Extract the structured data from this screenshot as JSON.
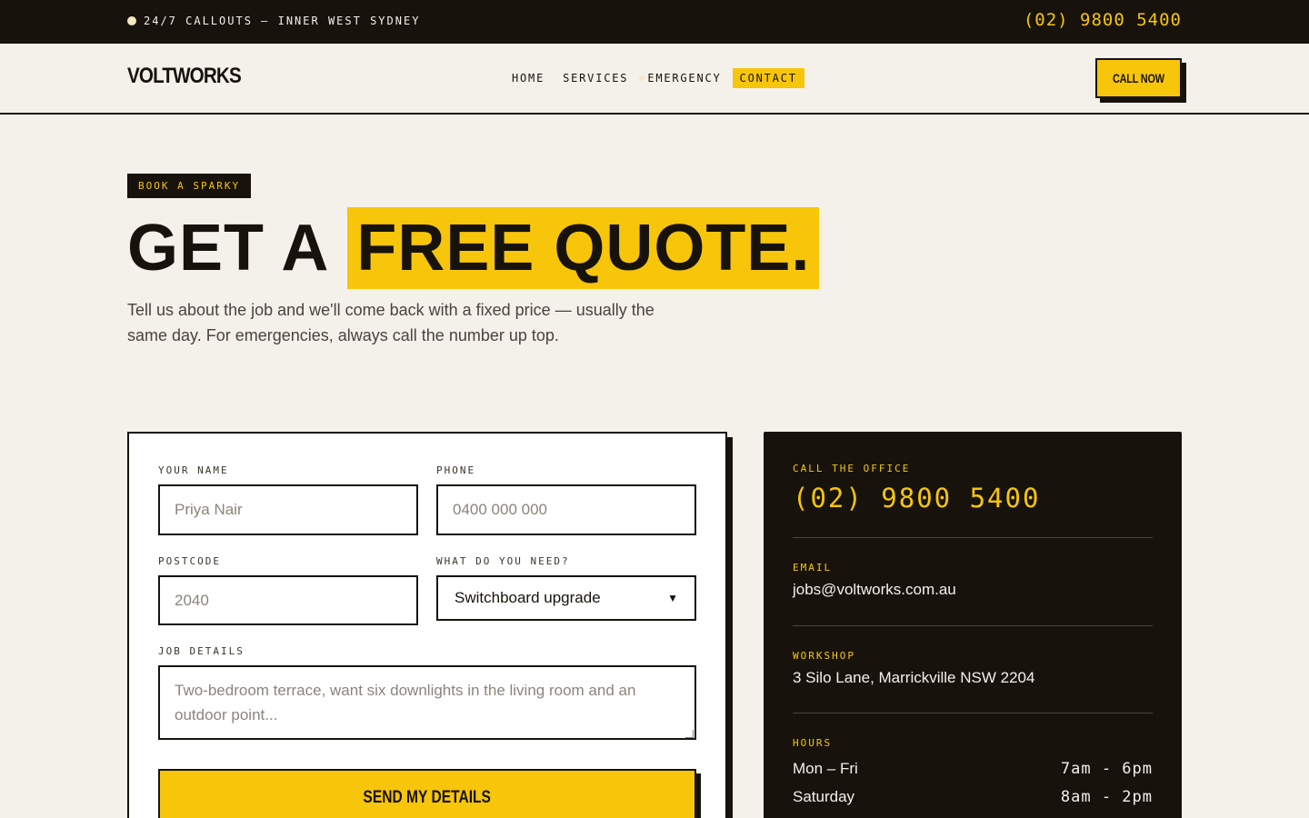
{
  "topbar": {
    "tagline": "24/7 CALLOUTS — INNER WEST SYDNEY",
    "phone": "(02) 9800 5400"
  },
  "header": {
    "logo": "VOLTWORKS",
    "nav": [
      {
        "label": "HOME"
      },
      {
        "label": "SERVICES"
      },
      {
        "label": "EMERGENCY"
      },
      {
        "label": "CONTACT",
        "active": true
      }
    ],
    "cta": "CALL NOW"
  },
  "hero": {
    "tag": "BOOK A SPARKY",
    "title_pre": "GET A",
    "title_highlight": "FREE QUOTE.",
    "lead": "Tell us about the job and we'll come back with a fixed price — usually the same day. For emergencies, always call the number up top."
  },
  "form": {
    "name_label": "YOUR NAME",
    "name_placeholder": "Priya Nair",
    "phone_label": "PHONE",
    "phone_placeholder": "0400 000 000",
    "postcode_label": "POSTCODE",
    "postcode_placeholder": "2040",
    "need_label": "WHAT DO YOU NEED?",
    "need_selected": "Switchboard upgrade",
    "details_label": "JOB DETAILS",
    "details_placeholder": "Two-bedroom terrace, want six downlights in the living room and an outdoor point...",
    "submit": "SEND MY DETAILS"
  },
  "info": {
    "call_label": "CALL THE OFFICE",
    "phone": "(02) 9800 5400",
    "email_label": "EMAIL",
    "email": "jobs@voltworks.com.au",
    "workshop_label": "WORKSHOP",
    "address": "3 Silo Lane, Marrickville NSW 2204",
    "hours_label": "HOURS",
    "hours": [
      {
        "day": "Mon – Fri",
        "time": "7am - 6pm"
      },
      {
        "day": "Saturday",
        "time": "8am - 2pm"
      }
    ]
  },
  "colors": {
    "accent": "#f7c50a",
    "dark": "#17130c",
    "background": "#f4f1ea"
  }
}
